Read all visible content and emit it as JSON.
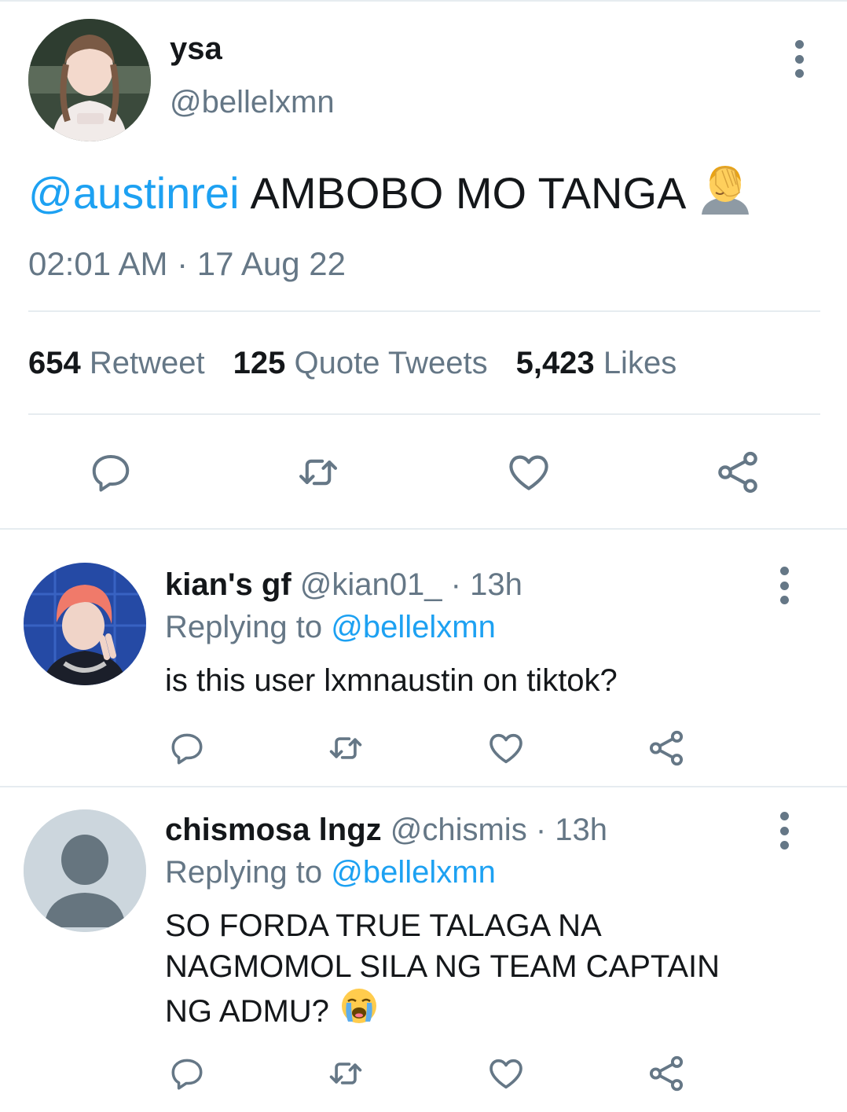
{
  "main_tweet": {
    "author_name": "ysa",
    "author_handle": "@bellelxmn",
    "mention": "@austinrei",
    "text": "AMBOBO MO TANGA",
    "emoji_icon": "face-palm-emoji",
    "timestamp": "02:01 AM · 17 Aug 22",
    "stats": {
      "retweets_count": "654",
      "retweets_label": "Retweet",
      "quotes_count": "125",
      "quotes_label": "Quote Tweets",
      "likes_count": "5,423",
      "likes_label": "Likes"
    }
  },
  "replies": [
    {
      "author_name": "kian's gf",
      "author_handle": "@kian01_",
      "time": "· 13h",
      "replying_label": "Replying to",
      "replying_to": "@bellelxmn",
      "text": "is this user lxmnaustin on tiktok?"
    },
    {
      "author_name": "chismosa lngz",
      "author_handle": "@chismis",
      "time": "· 13h",
      "replying_label": "Replying to",
      "replying_to": "@bellelxmn",
      "text_lines": [
        "SO FORDA TRUE TALAGA NA",
        "NAGMOMOL SILA NG TEAM CAPTAIN",
        "NG ADMU?"
      ],
      "emoji_icon": "loudly-crying-face-emoji"
    }
  ],
  "colors": {
    "accent": "#1da1f2",
    "muted": "#657786",
    "text": "#14171a",
    "divider": "#e6ecf0",
    "default_avatar_bg": "#ccd6dd",
    "default_avatar_fg": "#66757f"
  }
}
